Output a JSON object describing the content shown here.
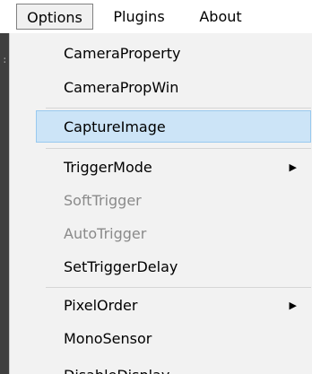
{
  "menubar": {
    "items": [
      {
        "label": "Options"
      },
      {
        "label": "Plugins"
      },
      {
        "label": "About"
      }
    ]
  },
  "menu": {
    "items": [
      {
        "label": "CameraProperty",
        "enabled": true,
        "submenu": false
      },
      {
        "label": "CameraPropWin",
        "enabled": true,
        "submenu": false
      },
      {
        "label": "CaptureImage",
        "enabled": true,
        "submenu": false,
        "highlighted": true
      },
      {
        "label": "TriggerMode",
        "enabled": true,
        "submenu": true
      },
      {
        "label": "SoftTrigger",
        "enabled": false,
        "submenu": false
      },
      {
        "label": "AutoTrigger",
        "enabled": false,
        "submenu": false
      },
      {
        "label": "SetTriggerDelay",
        "enabled": true,
        "submenu": false
      },
      {
        "label": "PixelOrder",
        "enabled": true,
        "submenu": true
      },
      {
        "label": "MonoSensor",
        "enabled": true,
        "submenu": false
      },
      {
        "label": "DisableDisplay",
        "enabled": true,
        "submenu": false
      }
    ],
    "submenu_arrow": "▶"
  },
  "colors": {
    "highlight_bg": "#cce4f7",
    "highlight_border": "#99c9ef",
    "disabled_text": "#8a8a8a",
    "menu_bg": "#f2f2f2"
  }
}
